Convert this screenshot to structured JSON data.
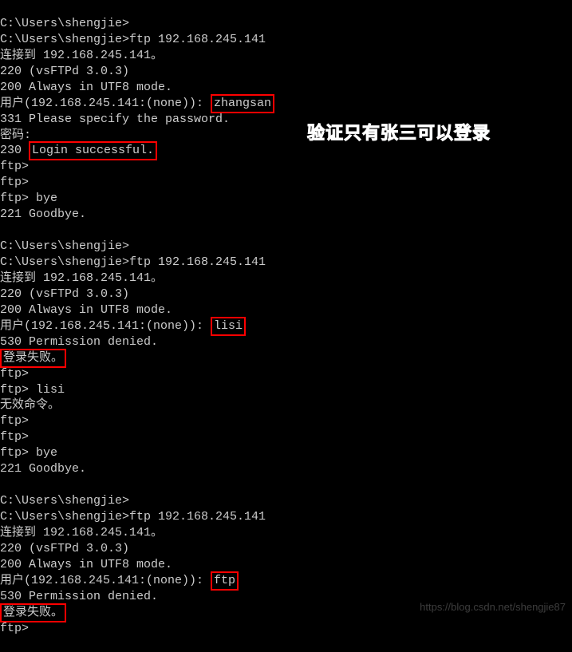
{
  "session1": {
    "prompt_prefix": "C:\\Users\\shengjie>",
    "cmd_ftp": "ftp 192.168.245.141",
    "connecting": "连接到 192.168.245.141。",
    "resp220": "220 (vsFTPd 3.0.3)",
    "resp200": "200 Always in UTF8 mode.",
    "user_prompt": "用户(192.168.245.141:(none)): ",
    "username": "zhangsan",
    "resp331": "331 Please specify the password.",
    "pwd_prompt": "密码:",
    "resp230_prefix": "230 ",
    "login_success": "Login successful.",
    "ftp_prompt": "ftp>",
    "bye_cmd": " bye",
    "resp221": "221 Goodbye."
  },
  "session2": {
    "prompt_prefix": "C:\\Users\\shengjie>",
    "cmd_ftp": "ftp 192.168.245.141",
    "connecting": "连接到 192.168.245.141。",
    "resp220": "220 (vsFTPd 3.0.3)",
    "resp200": "200 Always in UTF8 mode.",
    "user_prompt": "用户(192.168.245.141:(none)): ",
    "username": "lisi",
    "resp530": "530 Permission denied.",
    "login_fail": "登录失败。",
    "ftp_prompt": "ftp>",
    "lisi_cmd": " lisi",
    "invalid": "无效命令。",
    "bye_cmd": " bye",
    "resp221": "221 Goodbye."
  },
  "session3": {
    "prompt_prefix": "C:\\Users\\shengjie>",
    "cmd_ftp": "ftp 192.168.245.141",
    "connecting": "连接到 192.168.245.141。",
    "resp220": "220 (vsFTPd 3.0.3)",
    "resp200": "200 Always in UTF8 mode.",
    "user_prompt": "用户(192.168.245.141:(none)): ",
    "username": "ftp",
    "resp530": "530 Permission denied.",
    "login_fail": "登录失败。",
    "ftp_prompt": "ftp>"
  },
  "top_partial": "C:\\Users\\shengjie>",
  "annotation": "验证只有张三可以登录",
  "watermark": "https://blog.csdn.net/shengjie87"
}
